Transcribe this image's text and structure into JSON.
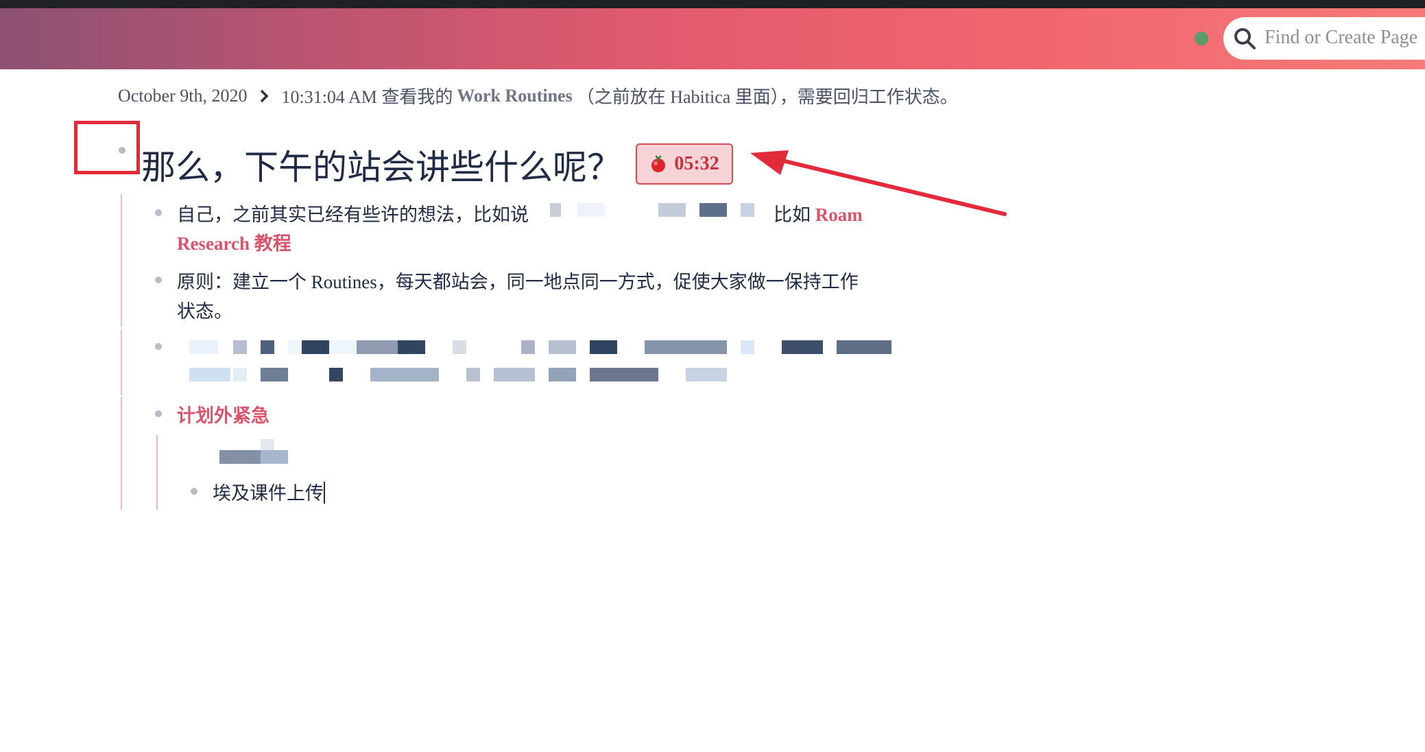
{
  "top_bar": {
    "search_placeholder": "Find or Create Page",
    "status_color": "#5b9a6a"
  },
  "breadcrumb": {
    "date": "October 9th, 2020",
    "time_prefix": "10:31:04 AM 查看我的",
    "link": "Work Routines",
    "suffix": "（之前放在 Habitica 里面），需要回归工作状态。"
  },
  "block": {
    "heading": "那么，下午的站会讲些什么呢？",
    "timer": "05:32",
    "children": [
      {
        "text_1": "自己，之前其实已经有些许的想法，比如说",
        "text_2": "比如",
        "link_1": "Roam",
        "link_2": "Research 教程"
      },
      {
        "line_1": "原则：建立一个 Routines，每天都站会，同一地点同一方式，促使大家做一保持工作",
        "line_2": "状态。"
      },
      {
        "redacted": true
      },
      {
        "title": "计划外紧急",
        "child": "埃及课件上传"
      }
    ]
  },
  "icons": [
    "search-icon",
    "chevron-right-icon",
    "tomato-icon",
    "arrow-annotation"
  ]
}
